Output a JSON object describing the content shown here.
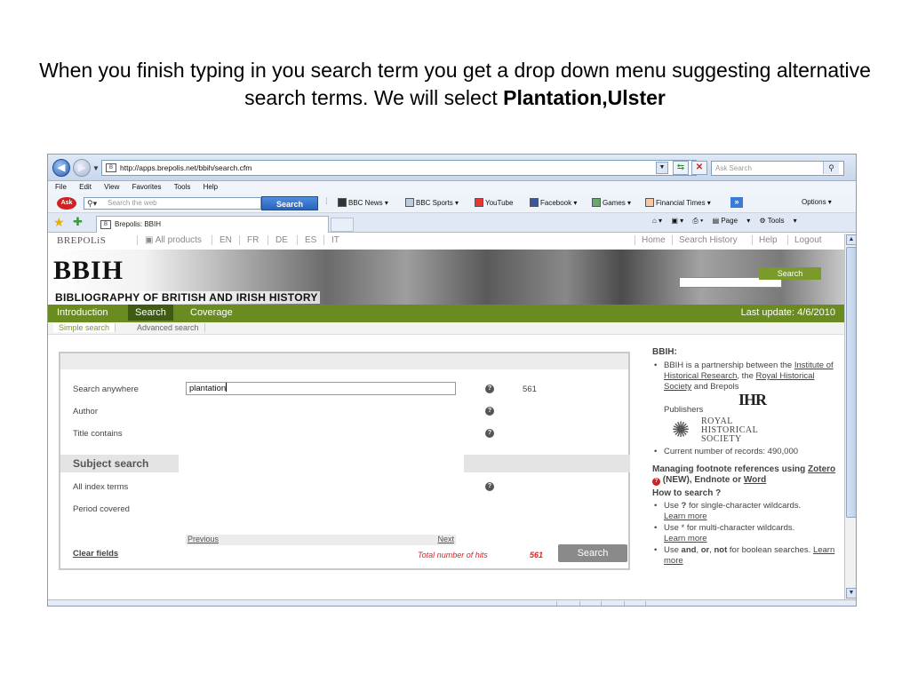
{
  "caption": {
    "text_before": "When you finish typing in you search term you get a drop down menu suggesting alternative search terms.  We will select ",
    "bold_term": "Plantation,Ulster"
  },
  "browser": {
    "url": "http://apps.brepolis.net/bbih/search.cfm",
    "ask_placeholder": "Ask Search",
    "menu": [
      "File",
      "Edit",
      "View",
      "Favorites",
      "Tools",
      "Help"
    ],
    "toolbar": {
      "search_placeholder": "Search the web",
      "search_button": "Search",
      "links": [
        "BBC News",
        "BBC Sports",
        "YouTube",
        "Facebook",
        "Games",
        "Financial Times"
      ],
      "options": "Options"
    },
    "tab_title": "Brepolis: BBIH",
    "command_bar": {
      "page": "Page",
      "tools": "Tools"
    }
  },
  "site": {
    "brand": "BREPOLiS",
    "top_links": [
      "All products",
      "EN",
      "FR",
      "DE",
      "ES",
      "IT"
    ],
    "right_links": [
      "Home",
      "Search History",
      "Help",
      "Logout"
    ],
    "logo": "BBIH",
    "logo_subtitle": "BIBLIOGRAPHY OF BRITISH AND IRISH HISTORY",
    "banner_search_button": "Search",
    "main_nav": [
      "Introduction",
      "Search",
      "Coverage"
    ],
    "last_update": "Last update: 4/6/2010",
    "sub_nav": [
      "Simple search",
      "Advanced search"
    ]
  },
  "form": {
    "search_anywhere_label": "Search anywhere",
    "search_anywhere_value": "plantation",
    "search_anywhere_hits": "561",
    "author_label": "Author",
    "title_label": "Title contains",
    "subject_header": "Subject search",
    "index_terms_label": "All index terms",
    "period_label": "Period covered",
    "previous": "Previous",
    "next": "Next",
    "clear_fields": "Clear fields",
    "total_hits_label": "Total number of hits",
    "total_hits_value": "561",
    "search_button": "Search"
  },
  "sidebar": {
    "heading": "BBIH:",
    "partnership_pre": "BBIH is a partnership between the ",
    "ihr_link": "Institute of Historical Research",
    "partnership_mid": ", the ",
    "rhs_link": "Royal Historical Society",
    "partnership_post": " and Brepols",
    "ihr_logo": "IHR",
    "publishers": "Publishers",
    "rhs_line1": "ROYAL",
    "rhs_line2": "HISTORICAL",
    "rhs_line3": "SOCIETY",
    "records": "Current number of records: 490,000",
    "footnote_pre": "Managing footnote references using ",
    "zotero": "Zotero",
    "footnote_mid": " (NEW), Endnote or ",
    "word": "Word",
    "howto": "How to search ?",
    "tip1_pre": "Use ",
    "tip1_sym": "?",
    "tip1_post": " for single-character wildcards.",
    "learn_more": "Learn more",
    "tip2": "Use * for multi-character wildcards.",
    "tip3_pre": "Use ",
    "tip3_and": "and",
    "tip3_or": "or",
    "tip3_not": "not",
    "tip3_post": " for boolean searches. "
  }
}
